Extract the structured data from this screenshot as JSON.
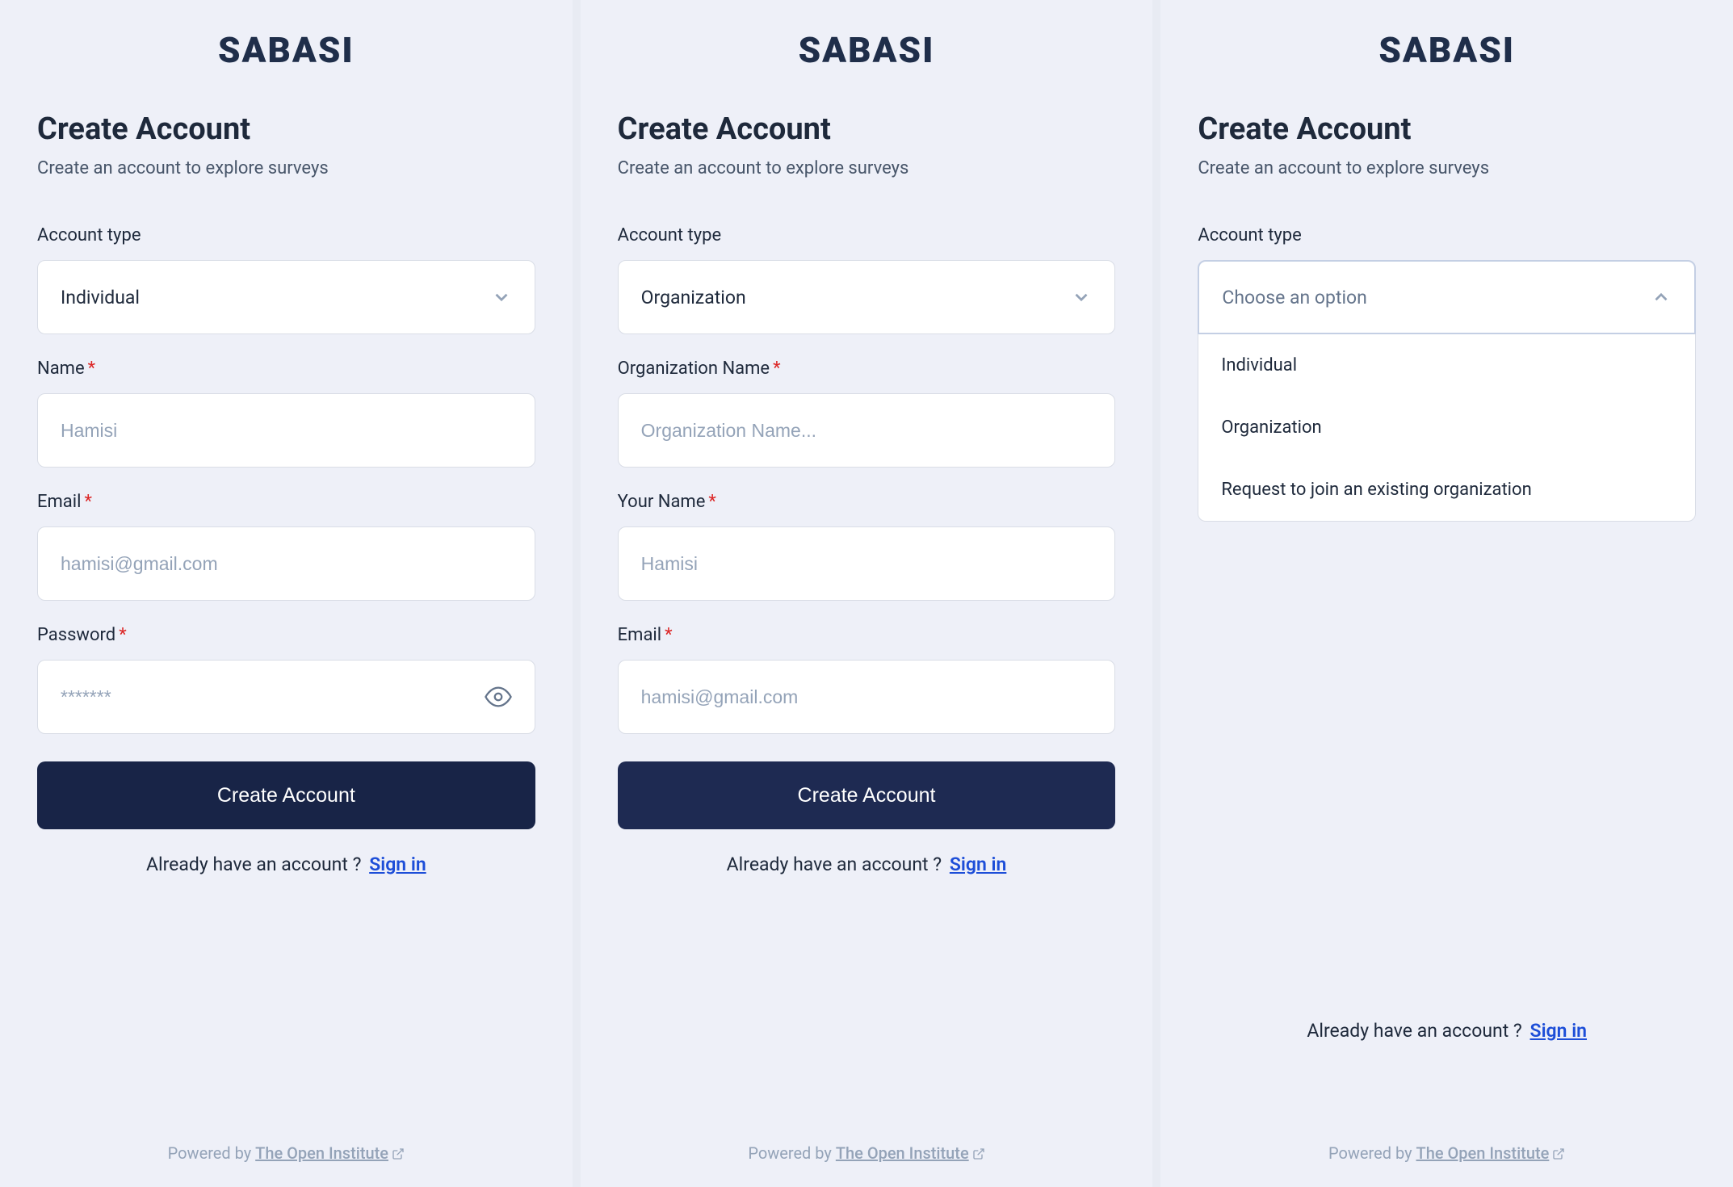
{
  "brand": "SABASI",
  "heading": "Create Account",
  "sub": "Create an account to explore surveys",
  "account_type_label": "Account type",
  "dropdown_placeholder": "Choose an option",
  "options": {
    "individual": "Individual",
    "organization": "Organization",
    "request": "Request to join an existing organization"
  },
  "panel1": {
    "selected": "Individual",
    "name_label": "Name",
    "name_placeholder": "Hamisi",
    "email_label": "Email",
    "email_placeholder": "hamisi@gmail.com",
    "password_label": "Password",
    "password_placeholder": "*******"
  },
  "panel2": {
    "selected": "Organization",
    "org_label": "Organization Name",
    "org_placeholder": "Organization Name...",
    "your_name_label": "Your Name",
    "your_name_placeholder": "Hamisi",
    "email_label": "Email",
    "email_placeholder": "hamisi@gmail.com"
  },
  "submit": "Create Account",
  "signin_prompt": "Already have an account ?",
  "signin_link": "Sign in",
  "footer_prefix": "Powered by ",
  "footer_link": "The Open Institute"
}
